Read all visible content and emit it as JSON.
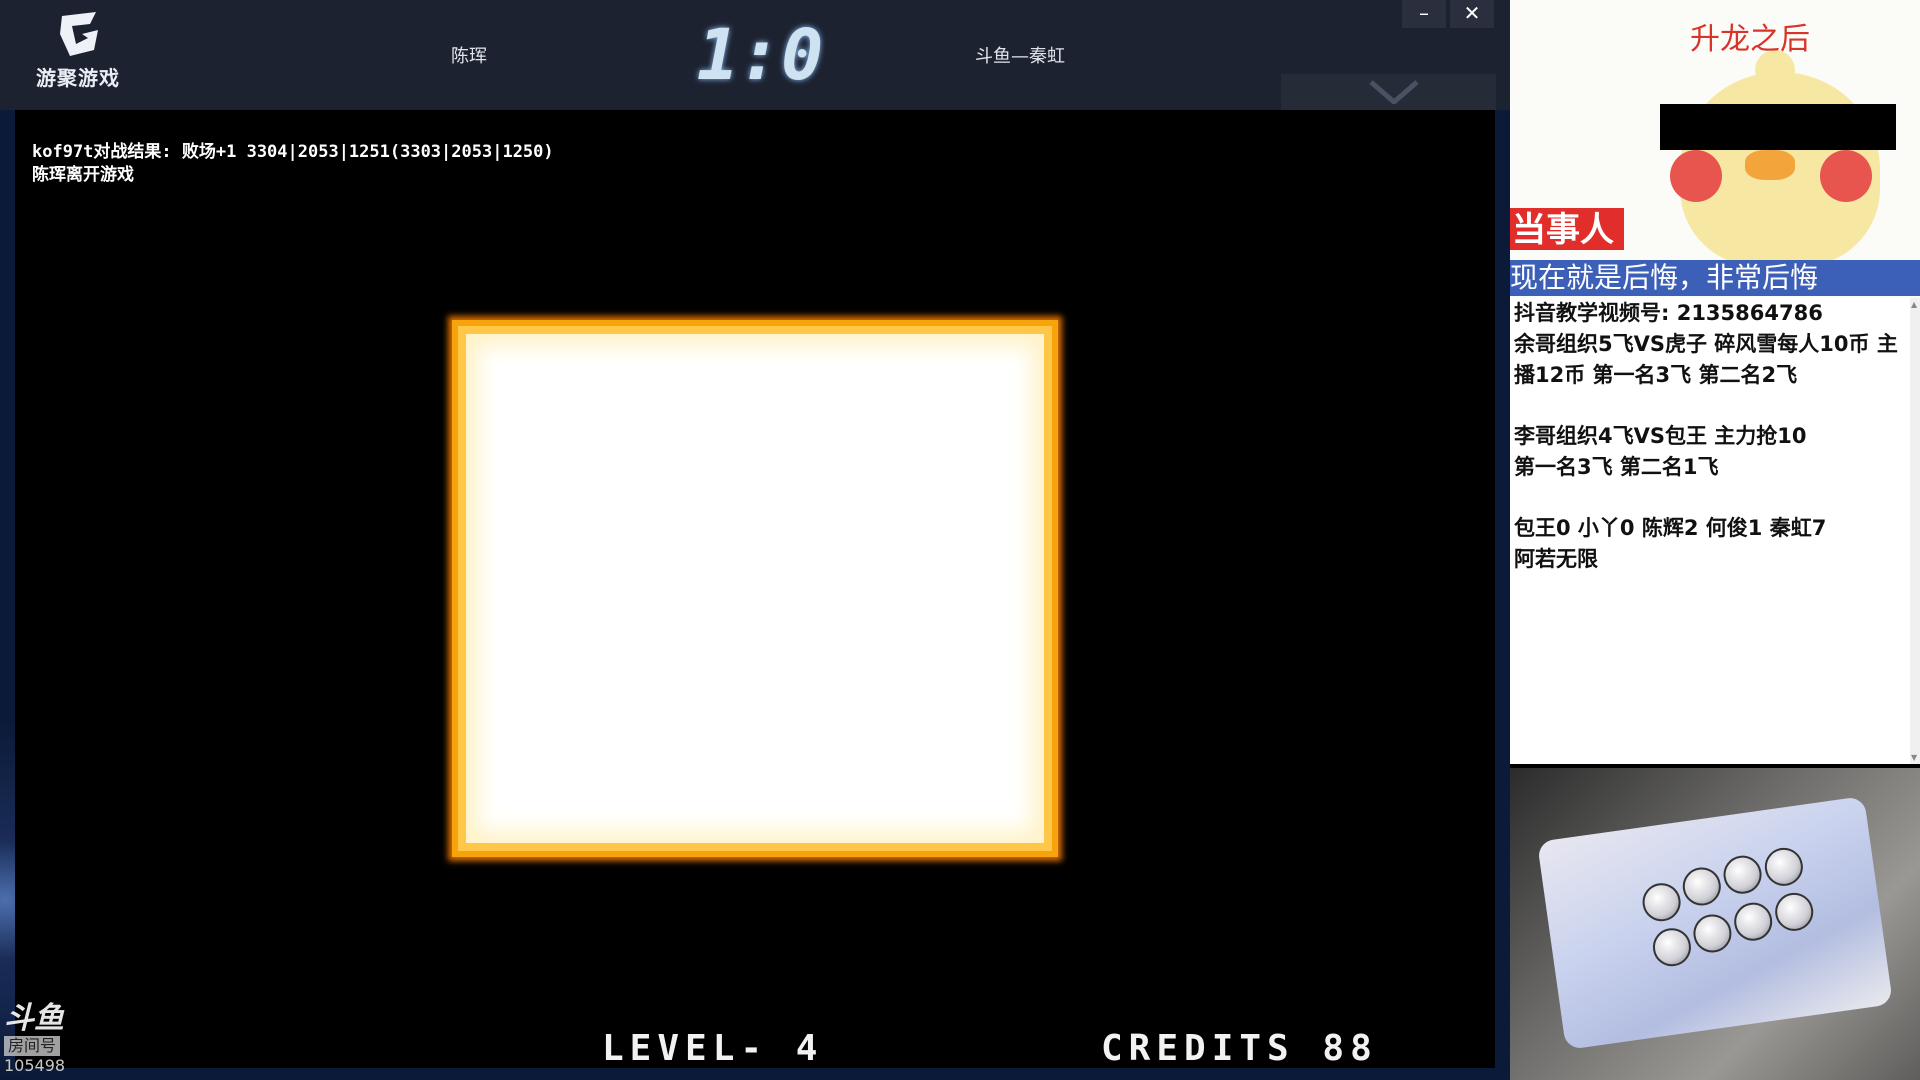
{
  "app": {
    "logo_text": "游聚游戏",
    "player_left": "陈珲",
    "score": "1:0",
    "player_right": "斗鱼—秦虹",
    "minimize_label": "–",
    "close_label": "✕"
  },
  "game": {
    "log_lines": [
      "kof97t对战结果: 败场+1 3304|2053|1251(3303|2053|1250)",
      "陈珲离开游戏"
    ],
    "level": "LEVEL- 4",
    "credits": "CREDITS 88"
  },
  "watermark": {
    "logo": "斗鱼",
    "room_label": "房间号",
    "room_id": "105498"
  },
  "meme": {
    "title": "升龙之后",
    "tag": "当事人",
    "subtitle": "现在就是后悔，非常后悔"
  },
  "info": {
    "lines": [
      "抖音教学视频号: 2135864786",
      "余哥组织5飞VS虎子  碎风雪每人10币 主",
      "播12币  第一名3飞   第二名2飞",
      "",
      "李哥组织4飞VS包王   主力抢10",
      "第一名3飞    第二名1飞",
      "",
      "包王0  小丫0  陈辉2  何俊1   秦虹7",
      "阿若无限"
    ]
  }
}
